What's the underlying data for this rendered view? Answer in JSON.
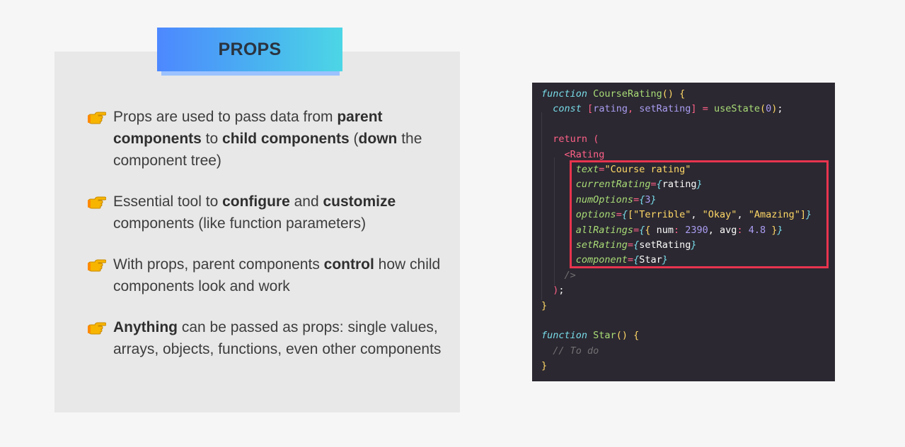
{
  "slide": {
    "title": "PROPS",
    "bullets": [
      {
        "icon": "pointing-hand-icon",
        "segments": [
          {
            "text": "Props are used to pass data from ",
            "bold": false
          },
          {
            "text": "parent components",
            "bold": true
          },
          {
            "text": " to ",
            "bold": false
          },
          {
            "text": "child components",
            "bold": true
          },
          {
            "text": " (",
            "bold": false
          },
          {
            "text": "down",
            "bold": true
          },
          {
            "text": " the component tree)",
            "bold": false
          }
        ]
      },
      {
        "icon": "pointing-hand-icon",
        "segments": [
          {
            "text": "Essential tool to ",
            "bold": false
          },
          {
            "text": "configure",
            "bold": true
          },
          {
            "text": " and ",
            "bold": false
          },
          {
            "text": "customize",
            "bold": true
          },
          {
            "text": " components (like function parameters)",
            "bold": false
          }
        ]
      },
      {
        "icon": "pointing-hand-icon",
        "segments": [
          {
            "text": "With props, parent components ",
            "bold": false
          },
          {
            "text": "control",
            "bold": true
          },
          {
            "text": " how child components look and work",
            "bold": false
          }
        ]
      },
      {
        "icon": "pointing-hand-icon",
        "segments": [
          {
            "text": "Anything",
            "bold": true
          },
          {
            "text": " can be passed as props: single values, arrays, objects, functions, even other components",
            "bold": false
          }
        ]
      }
    ]
  },
  "code": {
    "lines": [
      [
        [
          "kw",
          "function"
        ],
        [
          "var",
          " "
        ],
        [
          "fn",
          "CourseRating"
        ],
        [
          "pu",
          "()"
        ],
        [
          "var",
          " "
        ],
        [
          "pu",
          "{"
        ]
      ],
      [
        [
          "var",
          "  "
        ],
        [
          "kw",
          "const"
        ],
        [
          "var",
          " "
        ],
        [
          "pk",
          "["
        ],
        [
          "num",
          "rating"
        ],
        [
          "pk",
          ","
        ],
        [
          "var",
          " "
        ],
        [
          "num",
          "setRating"
        ],
        [
          "pk",
          "]"
        ],
        [
          "var",
          " "
        ],
        [
          "op",
          "="
        ],
        [
          "var",
          " "
        ],
        [
          "fn",
          "useState"
        ],
        [
          "pu",
          "("
        ],
        [
          "num",
          "0"
        ],
        [
          "pu",
          ")"
        ],
        [
          "var",
          ";"
        ]
      ],
      [],
      [
        [
          "var",
          "  "
        ],
        [
          "pk",
          "return"
        ],
        [
          "var",
          " "
        ],
        [
          "pk",
          "("
        ]
      ],
      [
        [
          "var",
          "    "
        ],
        [
          "tag",
          "<"
        ],
        [
          "tag",
          "Rating"
        ]
      ],
      [
        [
          "var",
          "      "
        ],
        [
          "attr",
          "text"
        ],
        [
          "op",
          "="
        ],
        [
          "str",
          "\"Course rating\""
        ]
      ],
      [
        [
          "var",
          "      "
        ],
        [
          "attr",
          "currentRating"
        ],
        [
          "op",
          "="
        ],
        [
          "kw",
          "{"
        ],
        [
          "var",
          "rating"
        ],
        [
          "kw",
          "}"
        ]
      ],
      [
        [
          "var",
          "      "
        ],
        [
          "attr",
          "numOptions"
        ],
        [
          "op",
          "="
        ],
        [
          "kw",
          "{"
        ],
        [
          "num",
          "3"
        ],
        [
          "kw",
          "}"
        ]
      ],
      [
        [
          "var",
          "      "
        ],
        [
          "attr",
          "options"
        ],
        [
          "op",
          "="
        ],
        [
          "kw",
          "{"
        ],
        [
          "pu",
          "["
        ],
        [
          "str",
          "\"Terrible\""
        ],
        [
          "var",
          ", "
        ],
        [
          "str",
          "\"Okay\""
        ],
        [
          "var",
          ", "
        ],
        [
          "str",
          "\"Amazing\""
        ],
        [
          "pu",
          "]"
        ],
        [
          "kw",
          "}"
        ]
      ],
      [
        [
          "var",
          "      "
        ],
        [
          "attr",
          "allRatings"
        ],
        [
          "op",
          "="
        ],
        [
          "kw",
          "{"
        ],
        [
          "pu",
          "{"
        ],
        [
          "var",
          " num"
        ],
        [
          "op",
          ":"
        ],
        [
          "var",
          " "
        ],
        [
          "num",
          "2390"
        ],
        [
          "var",
          ", avg"
        ],
        [
          "op",
          ":"
        ],
        [
          "var",
          " "
        ],
        [
          "num",
          "4.8"
        ],
        [
          "var",
          " "
        ],
        [
          "pu",
          "}"
        ],
        [
          "kw",
          "}"
        ]
      ],
      [
        [
          "var",
          "      "
        ],
        [
          "attr",
          "setRating"
        ],
        [
          "op",
          "="
        ],
        [
          "kw",
          "{"
        ],
        [
          "var",
          "setRating"
        ],
        [
          "kw",
          "}"
        ]
      ],
      [
        [
          "var",
          "      "
        ],
        [
          "attr",
          "component"
        ],
        [
          "op",
          "="
        ],
        [
          "kw",
          "{"
        ],
        [
          "var",
          "Star"
        ],
        [
          "kw",
          "}"
        ]
      ],
      [
        [
          "var",
          "    "
        ],
        [
          "cmt",
          "/>"
        ]
      ],
      [
        [
          "var",
          "  "
        ],
        [
          "pk",
          ")"
        ],
        [
          "var",
          ";"
        ]
      ],
      [
        [
          "pu",
          "}"
        ]
      ],
      [],
      [
        [
          "kw",
          "function"
        ],
        [
          "var",
          " "
        ],
        [
          "fn",
          "Star"
        ],
        [
          "pu",
          "()"
        ],
        [
          "var",
          " "
        ],
        [
          "pu",
          "{"
        ]
      ],
      [
        [
          "var",
          "  "
        ],
        [
          "cmt",
          "// To do"
        ]
      ],
      [
        [
          "pu",
          "}"
        ]
      ]
    ]
  }
}
